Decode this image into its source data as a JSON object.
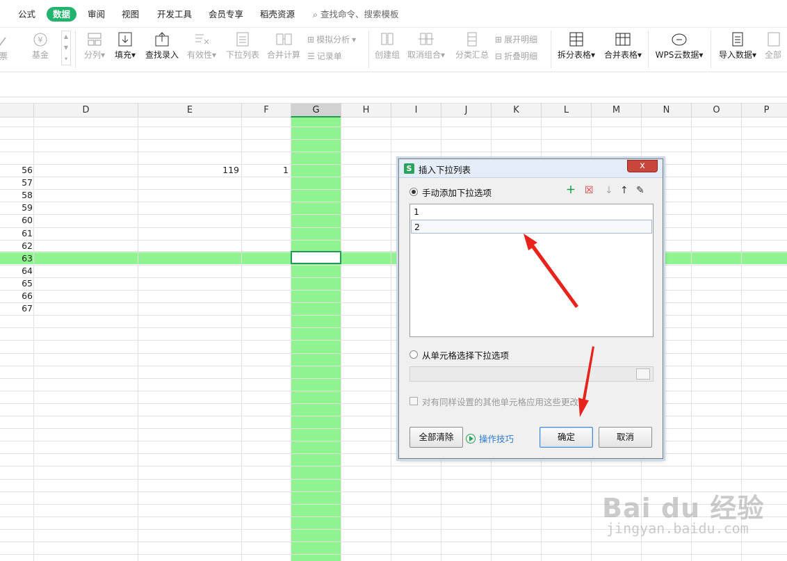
{
  "menu": {
    "tabs": [
      "公式",
      "数据",
      "审阅",
      "视图",
      "开发工具",
      "会员专享",
      "稻壳资源"
    ],
    "active_tab": "数据",
    "search": "查找命令、搜索模板"
  },
  "toolbar": {
    "left_partial": [
      "票",
      "基金"
    ],
    "fenlie": "分列",
    "tianchong": "填充",
    "chazhao": "查找录入",
    "youxiaoxing": "有效性",
    "xiala": "下拉列表",
    "hebing": "合并计算",
    "moni": "模拟分析",
    "jilu": "记录单",
    "chuangjian": "创建组",
    "quxiao": "取消组合",
    "fenlei": "分类汇总",
    "zhankai": "展开明细",
    "zhedie": "折叠明细",
    "chaifen": "拆分表格",
    "hebingbiaoge": "合并表格",
    "wps": "WPS云数据",
    "daoru": "导入数据",
    "quanbu": "全部"
  },
  "columns": [
    "D",
    "E",
    "F",
    "G",
    "H",
    "I",
    "J",
    "K",
    "L",
    "M",
    "N",
    "O",
    "P"
  ],
  "selected_column": "G",
  "row_numbers": [
    "56",
    "57",
    "58",
    "59",
    "60",
    "61",
    "62",
    "63",
    "64",
    "65",
    "66",
    "67"
  ],
  "cells": {
    "e56": "119",
    "f56": "1"
  },
  "dialog": {
    "title": "插入下拉列表",
    "close": "x",
    "opt_manual": "手动添加下拉选项",
    "items": [
      "1",
      "2"
    ],
    "opt_cells": "从单元格选择下拉选项",
    "apply_label": "对有同样设置的其他单元格应用这些更改(",
    "clear_all": "全部清除",
    "tips": "操作技巧",
    "ok": "确定",
    "cancel": "取消"
  },
  "watermark": {
    "text": "Bai du 经验",
    "url": "jingyan.baidu.com"
  },
  "colors": {
    "accent": "#22b36d",
    "highlight": "#8ff48f",
    "arrow": "#e8231c",
    "link": "#2d7bd6"
  }
}
